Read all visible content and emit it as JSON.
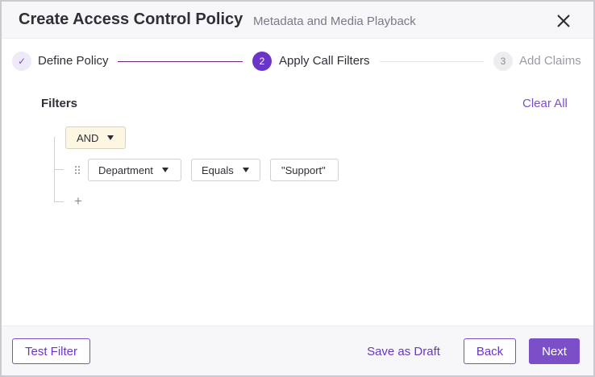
{
  "header": {
    "title": "Create Access Control Policy",
    "subtitle": "Metadata and Media Playback",
    "close_icon": "close-icon"
  },
  "stepper": {
    "steps": [
      {
        "number": "✓",
        "label": "Define Policy",
        "state": "completed"
      },
      {
        "number": "2",
        "label": "Apply Call Filters",
        "state": "active"
      },
      {
        "number": "3",
        "label": "Add Claims",
        "state": "upcoming"
      }
    ]
  },
  "filters": {
    "title": "Filters",
    "clear_all_label": "Clear All",
    "logic_operator": "AND",
    "condition": {
      "field": "Department",
      "operator": "Equals",
      "value": "\"Support\""
    },
    "add_icon": "+"
  },
  "footer": {
    "test_filter_label": "Test Filter",
    "save_draft_label": "Save as Draft",
    "back_label": "Back",
    "next_label": "Next"
  },
  "colors": {
    "accent": "#7a4fc8",
    "accent_dark": "#6b35c9",
    "and_chip_bg": "#fdf6e3"
  }
}
